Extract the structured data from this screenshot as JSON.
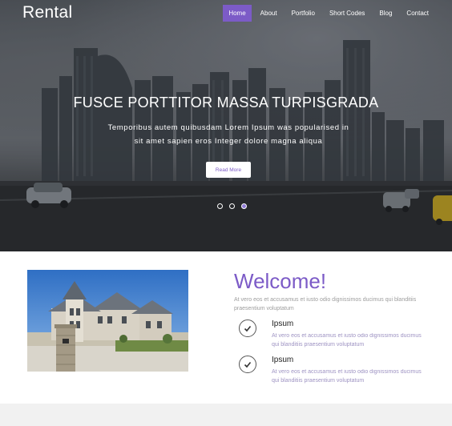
{
  "site": {
    "logo": "Rental"
  },
  "nav": {
    "items": [
      {
        "label": "Home",
        "active": true
      },
      {
        "label": "About",
        "active": false
      },
      {
        "label": "Portfolio",
        "active": false
      },
      {
        "label": "Short Codes",
        "active": false
      },
      {
        "label": "Blog",
        "active": false
      },
      {
        "label": "Contact",
        "active": false
      }
    ]
  },
  "hero": {
    "title": "FUSCE PORTTITOR MASSA TURPISGRADA",
    "subtitle_line1": "Temporibus autem quibusdam Lorem Ipsum was popularised in",
    "subtitle_line2": "sit amet sapien eros Integer dolore magna aliqua",
    "button_label": "Read More",
    "slides": [
      {
        "active": false
      },
      {
        "active": false
      },
      {
        "active": true
      }
    ]
  },
  "welcome": {
    "heading": "Welcome!",
    "intro": "At vero eos et accusamus et iusto odio dignissimos ducimus qui blanditiis praesentium voluptatum",
    "features": [
      {
        "icon": "check-icon",
        "title": "Ipsum",
        "text": "At vero eos et accusamus et iusto odio dignissimos ducimus qui blanditiis praesentium voluptatum"
      },
      {
        "icon": "check-icon",
        "title": "Ipsum",
        "text": "At vero eos et accusamus et iusto odio dignissimos ducimus qui blanditiis praesentium voluptatum"
      }
    ]
  },
  "colors": {
    "accent": "#7c5bc7",
    "muted_text": "#9d9d9d",
    "hero_text": "#ffffff"
  }
}
